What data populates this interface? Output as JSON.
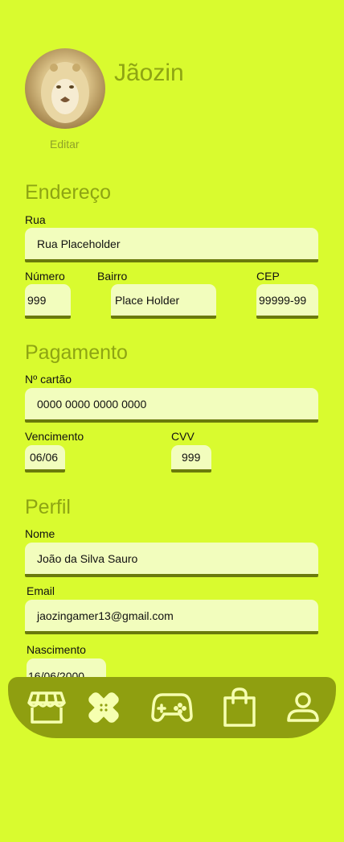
{
  "profile": {
    "name": "Jãozin",
    "edit_label": "Editar"
  },
  "address": {
    "title": "Endereço",
    "street_label": "Rua",
    "street_value": "Rua Placeholder",
    "number_label": "Número",
    "number_value": "999",
    "neighborhood_label": "Bairro",
    "neighborhood_value": "Place Holder",
    "cep_label": "CEP",
    "cep_value": "99999-99"
  },
  "payment": {
    "title": "Pagamento",
    "card_label": "Nº cartão",
    "card_value": "0000 0000 0000 0000",
    "expiry_label": "Vencimento",
    "expiry_value": "06/06",
    "cvv_label": "CVV",
    "cvv_value": "999"
  },
  "personal": {
    "title": "Perfil",
    "name_label": "Nome",
    "name_value": "João da Silva Sauro",
    "email_label": "Email",
    "email_value": "jaozingamer13@gmail.com",
    "birth_label": "Nascimento",
    "birth_value": "16/06/2000"
  },
  "nav": {
    "items": [
      "store-icon",
      "bandage-icon",
      "gamepad-icon",
      "shopping-bag-icon",
      "user-icon"
    ]
  },
  "colors": {
    "background": "#d9fb2f",
    "accent_text": "#8ea513",
    "field_bg": "#f2fdbd",
    "field_border": "#6a7a0c",
    "nav_bg": "#8f9f10",
    "nav_icon": "#f6ffb0"
  }
}
